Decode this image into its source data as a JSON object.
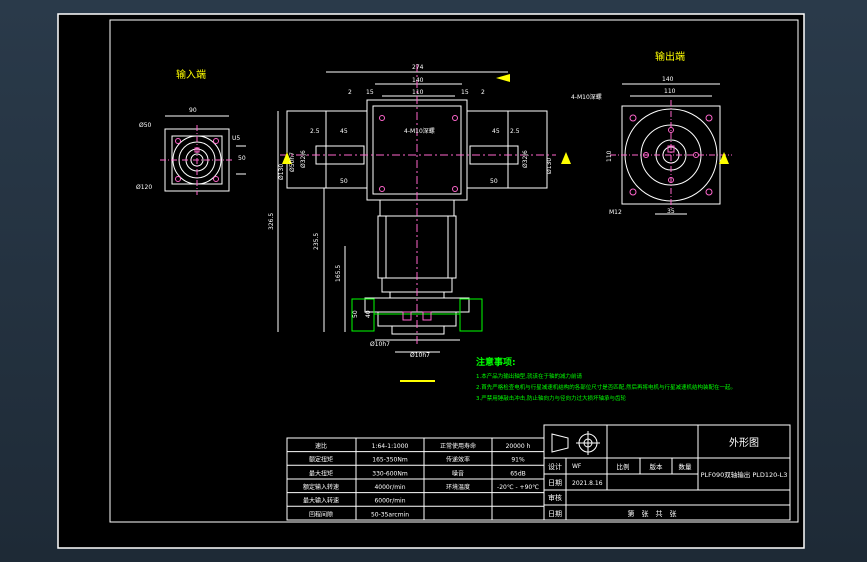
{
  "drawing": {
    "input_end_label": "输入端",
    "output_end_label": "输出端",
    "frame_color": "#ffffff",
    "accent_color": "#ffff00",
    "notes_color": "#00ff00",
    "dimension_color": "#ff66cc"
  },
  "dimensions": {
    "left_90": "90",
    "left_d50": "Ø50",
    "left_u5": "U5",
    "left_50": "50",
    "left_d120": "Ø120",
    "top_274": "274",
    "top_140": "140",
    "top_110": "110",
    "top_2a": "2",
    "top_15a": "15",
    "top_15b": "15",
    "top_2b": "2",
    "side_2_5a": "2.5",
    "side_45a": "45",
    "side_50a": "50",
    "side_2_5b": "2.5",
    "side_45b": "45",
    "side_50b": "50",
    "hole_note_front": "4-M10深螺",
    "d130": "Ø130",
    "d50h7a": "Ø50h7",
    "d32j6a": "Ø32j6",
    "d32j6b": "Ø32j6",
    "d130b": "Ø130",
    "v326": "326.5",
    "v235": "235.5",
    "v165": "165.5",
    "s50": "50",
    "s40": "40",
    "d10h7": "Ø10h7",
    "d10h7b": "Ø10h7",
    "right_140": "140",
    "right_110": "110",
    "right_hole": "4-M10深螺",
    "right_110v": "110",
    "right_m12": "M12",
    "right_35": "35"
  },
  "notes": {
    "title": "注意事项:",
    "line1": "1.本产品为输出轴型,就该在于轴的减力前请",
    "line2": "2.首先严格检查电机与行星减速机结构的各部位尺寸是否匹配,然后再将电机与行星减速机结构装配在一起。",
    "line3": "3.严禁用锤敲击冲击,防止轴向力与径向力过大损坏轴承与齿轮"
  },
  "spec_table": {
    "rows": [
      {
        "k1": "速比",
        "v1": "1:64-1:1000",
        "k2": "正常使用寿命",
        "v2": "20000 h"
      },
      {
        "k1": "额定扭矩",
        "v1": "165-350Nm",
        "k2": "传递效率",
        "v2": "91%"
      },
      {
        "k1": "最大扭矩",
        "v1": "330-600Nm",
        "k2": "噪音",
        "v2": "65dB"
      },
      {
        "k1": "额定输入转速",
        "v1": "4000r/min",
        "k2": "环境温度",
        "v2": "-20℃ - +90℃"
      },
      {
        "k1": "最大输入转速",
        "v1": "6000r/min",
        "k2": "",
        "v2": ""
      },
      {
        "k1": "回程间隙",
        "v1": "50-35arcmin",
        "k2": "",
        "v2": ""
      }
    ]
  },
  "title_block": {
    "drawing_title": "外形图",
    "design_label": "设计",
    "design_value": "WF",
    "scale_label": "比例",
    "version_label": "版本",
    "quantity_label": "数量",
    "part_name": "PLF090双轴输出 PLD120-L3",
    "date_label": "日期",
    "date_value": "2021.8.16",
    "review_label": "审核",
    "date2_label": "日期",
    "sheet_text": "第　张　共　张"
  }
}
